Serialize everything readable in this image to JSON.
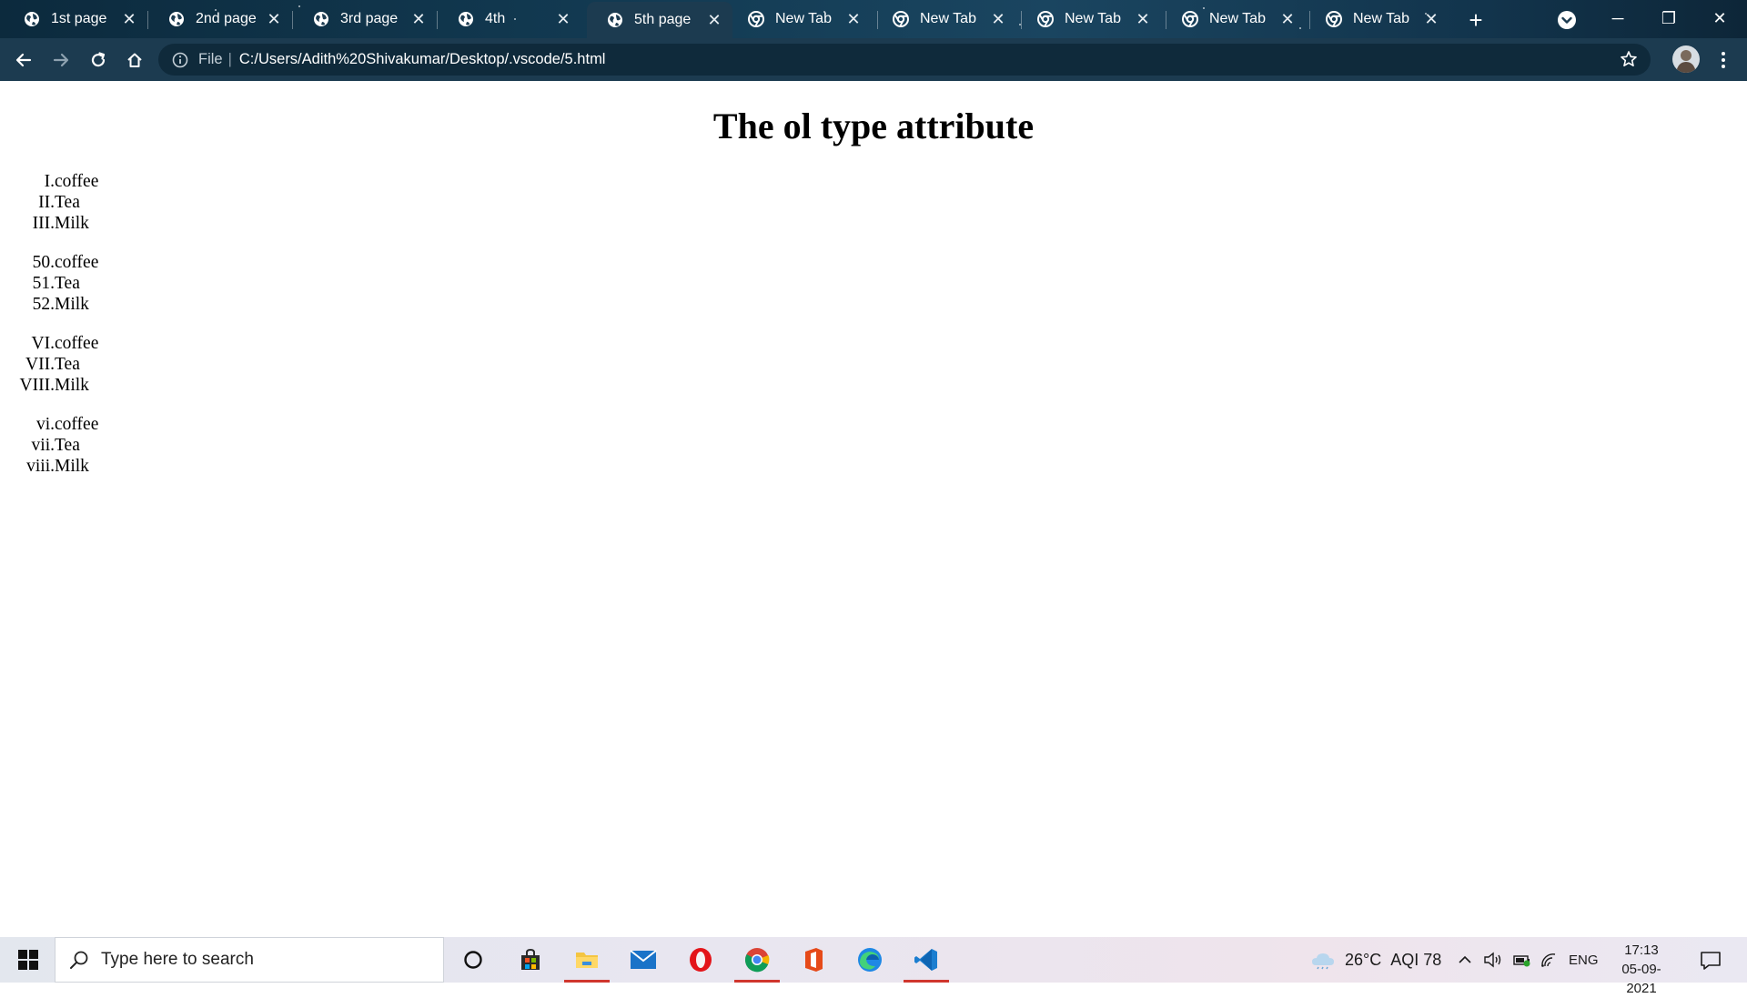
{
  "browser": {
    "tabs": [
      {
        "title": "1st page",
        "icon": "globe-icon",
        "active": false
      },
      {
        "title": "2nd page",
        "icon": "globe-icon",
        "active": false
      },
      {
        "title": "3rd page",
        "icon": "globe-icon",
        "active": false
      },
      {
        "title": "4th",
        "icon": "globe-icon",
        "active": false
      },
      {
        "title": "5th page",
        "icon": "globe-icon",
        "active": true
      },
      {
        "title": "New Tab",
        "icon": "chrome-icon",
        "active": false
      },
      {
        "title": "New Tab",
        "icon": "chrome-icon",
        "active": false
      },
      {
        "title": "New Tab",
        "icon": "chrome-icon",
        "active": false
      },
      {
        "title": "New Tab",
        "icon": "chrome-icon",
        "active": false
      },
      {
        "title": "New Tab",
        "icon": "chrome-icon",
        "active": false
      }
    ],
    "tab_close_glyph": "✕",
    "new_tab_glyph": "+",
    "window_controls": {
      "minimize": "─",
      "maximize": "❐",
      "close": "✕"
    },
    "omnibox": {
      "scheme_label": "File",
      "divider": "|",
      "url": "C:/Users/Adith%20Shivakumar/Desktop/.vscode/5.html"
    },
    "colors": {
      "frame": "#0c2a3d",
      "toolbar": "#1c3b50",
      "omnibox": "#0f2a3b"
    }
  },
  "page": {
    "title": "The ol type attribute",
    "lists": [
      {
        "items": [
          {
            "marker": "I.",
            "text": "coffee"
          },
          {
            "marker": "II.",
            "text": "Tea"
          },
          {
            "marker": "III.",
            "text": "Milk"
          }
        ]
      },
      {
        "items": [
          {
            "marker": "50.",
            "text": "coffee"
          },
          {
            "marker": "51.",
            "text": "Tea"
          },
          {
            "marker": "52.",
            "text": "Milk"
          }
        ]
      },
      {
        "items": [
          {
            "marker": "VI.",
            "text": "coffee"
          },
          {
            "marker": "VII.",
            "text": "Tea"
          },
          {
            "marker": "VIII.",
            "text": "Milk"
          }
        ]
      },
      {
        "items": [
          {
            "marker": "vi.",
            "text": "coffee"
          },
          {
            "marker": "vii.",
            "text": "Tea"
          },
          {
            "marker": "viii.",
            "text": "Milk"
          }
        ]
      }
    ]
  },
  "taskbar": {
    "search_placeholder": "Type here to search",
    "apps": [
      {
        "name": "cortana-icon",
        "running": false
      },
      {
        "name": "store-icon",
        "running": false
      },
      {
        "name": "file-explorer-icon",
        "running": true
      },
      {
        "name": "mail-icon",
        "running": false
      },
      {
        "name": "opera-icon",
        "running": false
      },
      {
        "name": "chrome-icon",
        "running": true
      },
      {
        "name": "office-icon",
        "running": false
      },
      {
        "name": "edge-icon",
        "running": false
      },
      {
        "name": "vscode-icon",
        "running": true
      }
    ],
    "weather": {
      "temp": "26°C",
      "aqi": "AQI 78"
    },
    "language": "ENG",
    "time": "17:13",
    "date": "05-09-2021"
  }
}
